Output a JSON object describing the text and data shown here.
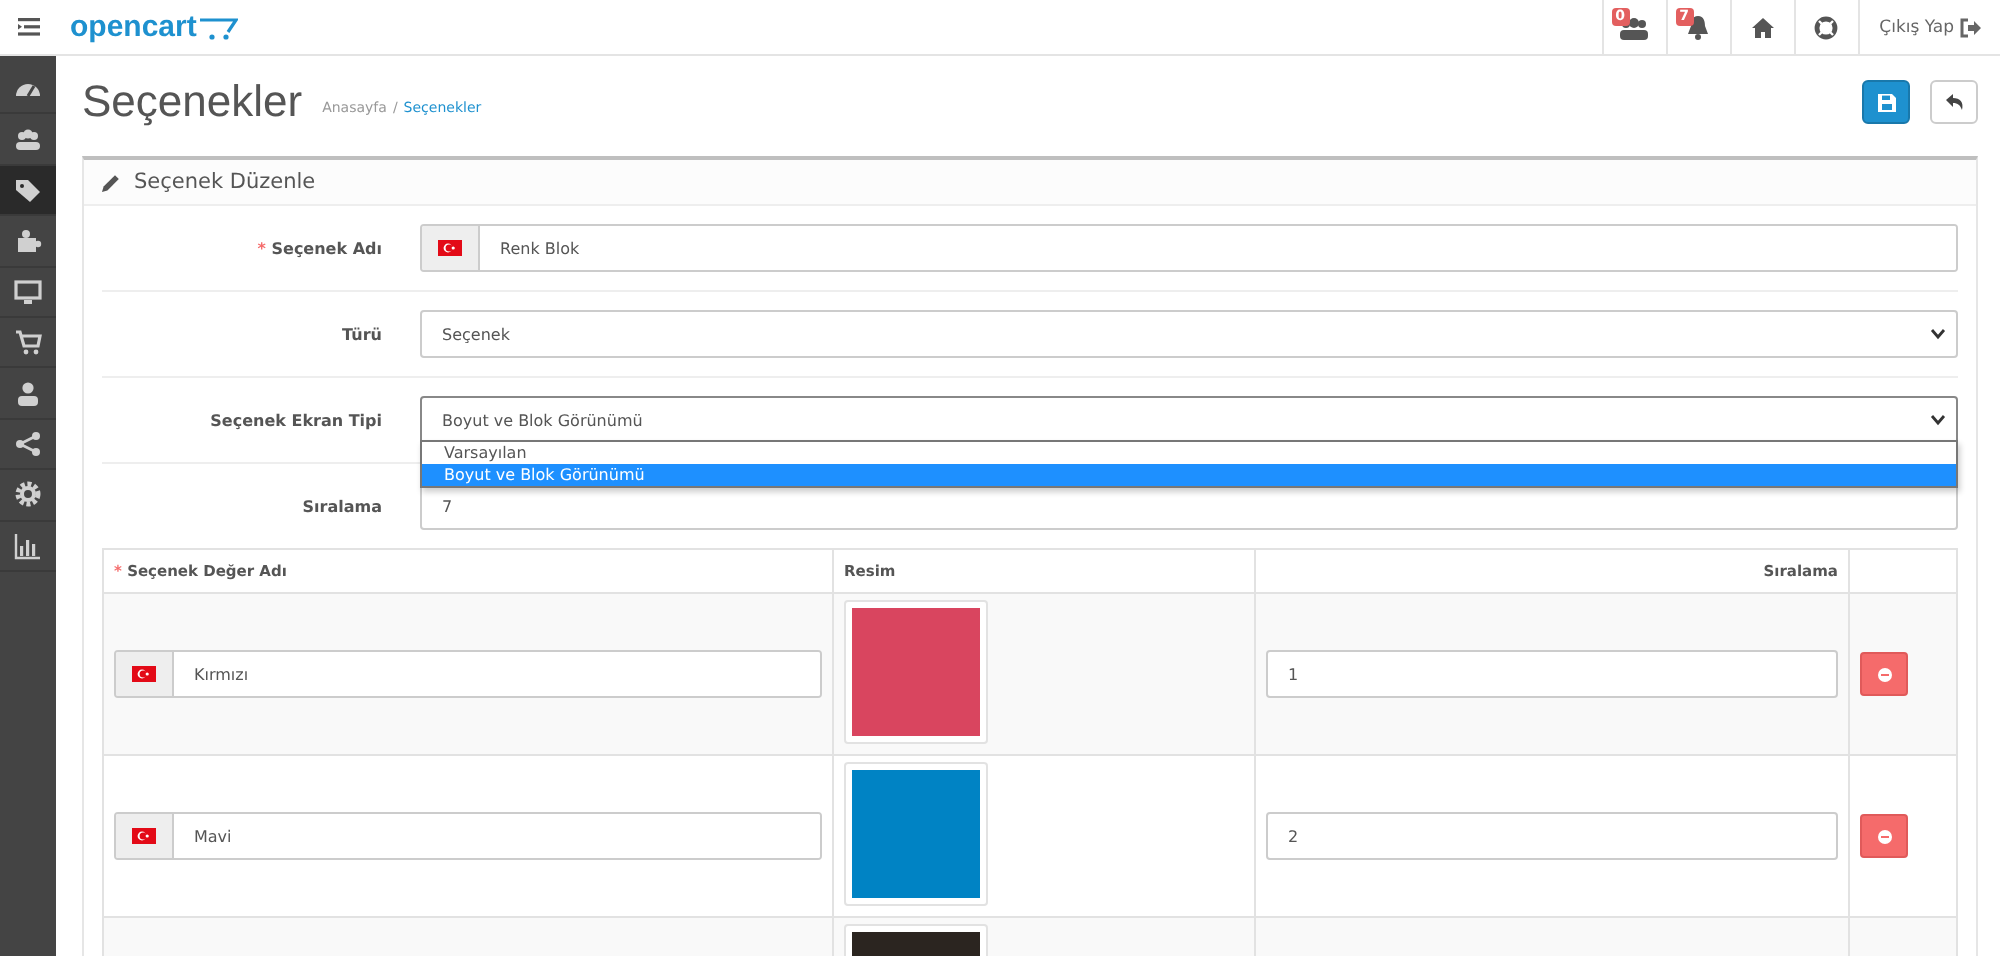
{
  "header": {
    "logo": "opencart",
    "notifications": [
      {
        "kind": "customers",
        "count": "0"
      },
      {
        "kind": "bell",
        "count": "7"
      }
    ],
    "logout": "Çıkış Yap"
  },
  "sidebar": {
    "items": [
      {
        "kind": "dashboard",
        "selected": false
      },
      {
        "kind": "users",
        "selected": false
      },
      {
        "kind": "tags",
        "selected": true
      },
      {
        "kind": "puzzle",
        "selected": false
      },
      {
        "kind": "monitor",
        "selected": false
      },
      {
        "kind": "cart",
        "selected": false
      },
      {
        "kind": "user",
        "selected": false
      },
      {
        "kind": "share",
        "selected": false
      },
      {
        "kind": "gear",
        "selected": false
      },
      {
        "kind": "chart",
        "selected": false
      }
    ]
  },
  "page": {
    "title": "Seçenekler",
    "breadcrumb": [
      "Anasayfa",
      "Seçenekler"
    ],
    "breadcrumb_separator": "/"
  },
  "panel": {
    "title": "Seçenek Düzenle",
    "fields": [
      {
        "kind": "lang-input",
        "label": "Seçenek Adı",
        "required_mark": "*",
        "value": "Renk Blok"
      },
      {
        "kind": "select",
        "label": "Türü",
        "value": "Seçenek"
      },
      {
        "kind": "select",
        "label": "Seçenek Ekran Tipi",
        "value": "Boyut ve Blok Görünümü",
        "options": [
          {
            "label": "Varsayılan",
            "selected": false
          },
          {
            "label": "Boyut ve Blok Görünümü",
            "selected": true
          }
        ]
      },
      {
        "kind": "input",
        "label": "Sıralama",
        "value": "7"
      }
    ],
    "table": {
      "columns": [
        {
          "label": "Seçenek Değer Adı",
          "required_mark": "*"
        },
        {
          "label": "Resim"
        },
        {
          "label": "Sıralama"
        }
      ],
      "rows": [
        {
          "name": "Kırmızı",
          "color": "#d9455f",
          "order": "1"
        },
        {
          "name": "Mavi",
          "color": "#0083c4",
          "order": "2"
        },
        {
          "color": "#2b2520"
        }
      ]
    }
  }
}
